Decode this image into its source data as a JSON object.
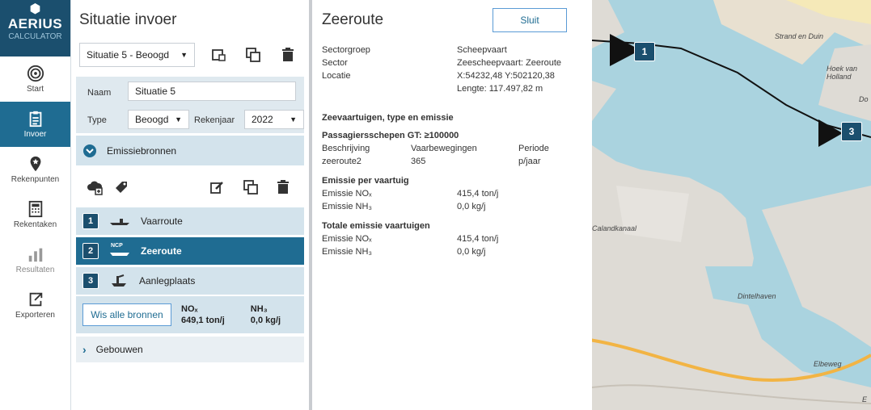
{
  "app": {
    "logo_line1": "AERIUS",
    "logo_line2": "CALCULATOR"
  },
  "nav": [
    {
      "label": "Start",
      "icon": "target-icon",
      "active": false
    },
    {
      "label": "Invoer",
      "icon": "clipboard-icon",
      "active": true
    },
    {
      "label": "Rekenpunten",
      "icon": "map-pin-icon",
      "active": false
    },
    {
      "label": "Rekentaken",
      "icon": "calculator-icon",
      "active": false
    },
    {
      "label": "Resultaten",
      "icon": "chart-icon",
      "active": false
    },
    {
      "label": "Exporteren",
      "icon": "export-icon",
      "active": false
    }
  ],
  "situation": {
    "title": "Situatie invoer",
    "selected": "Situatie 5 - Beoogd",
    "name_label": "Naam",
    "name_value": "Situatie 5",
    "type_label": "Type",
    "type_value": "Beoogd",
    "year_label": "Rekenjaar",
    "year_value": "2022"
  },
  "sources": {
    "section_label": "Emissiebronnen",
    "items": [
      {
        "num": "1",
        "label": "Vaarroute",
        "icon": "inland-ship-icon",
        "selected": false
      },
      {
        "num": "2",
        "label": "Zeeroute",
        "icon": "sea-ship-icon",
        "icon_text": "NCP",
        "selected": true
      },
      {
        "num": "3",
        "label": "Aanlegplaats",
        "icon": "mooring-icon",
        "selected": false
      }
    ],
    "clear_button": "Wis alle bronnen",
    "nox_label": "NOₓ",
    "nox_value": "649,1 ton/j",
    "nh3_label": "NH₃",
    "nh3_value": "0,0 kg/j"
  },
  "buildings": {
    "label": "Gebouwen"
  },
  "detail": {
    "title": "Zeeroute",
    "close_button": "Sluit",
    "sectorgroep_label": "Sectorgroep",
    "sectorgroep_value": "Scheepvaart",
    "sector_label": "Sector",
    "sector_value": "Zeescheepvaart: Zeeroute",
    "locatie_label": "Locatie",
    "locatie_value": "X:54232,48 Y:502120,38",
    "lengte_value": "Lengte: 117.497,82 m",
    "vessels_heading": "Zeevaartuigen, type en emissie",
    "ship_type": "Passagiersschepen GT: ≥100000",
    "col_beschrijving": "Beschrijving",
    "col_vaarbewegingen": "Vaarbewegingen",
    "col_periode": "Periode",
    "val_beschrijving": "zeeroute2",
    "val_vaarbewegingen": "365",
    "val_periode": "p/jaar",
    "per_vessel_heading": "Emissie per vaartuig",
    "per_nox_label": "Emissie NOₓ",
    "per_nox_value": "415,4 ton/j",
    "per_nh3_label": "Emissie NH₃",
    "per_nh3_value": "0,0 kg/j",
    "total_heading": "Totale emissie vaartuigen",
    "tot_nox_label": "Emissie NOₓ",
    "tot_nox_value": "415,4 ton/j",
    "tot_nh3_label": "Emissie NH₃",
    "tot_nh3_value": "0,0 kg/j"
  },
  "map": {
    "labels": [
      "Strand en Duin",
      "Hoek van Holland",
      "Do",
      "Calandkanaal",
      "Dintelhaven",
      "Elbeweg",
      "E"
    ],
    "badges": [
      "1",
      "3"
    ]
  }
}
